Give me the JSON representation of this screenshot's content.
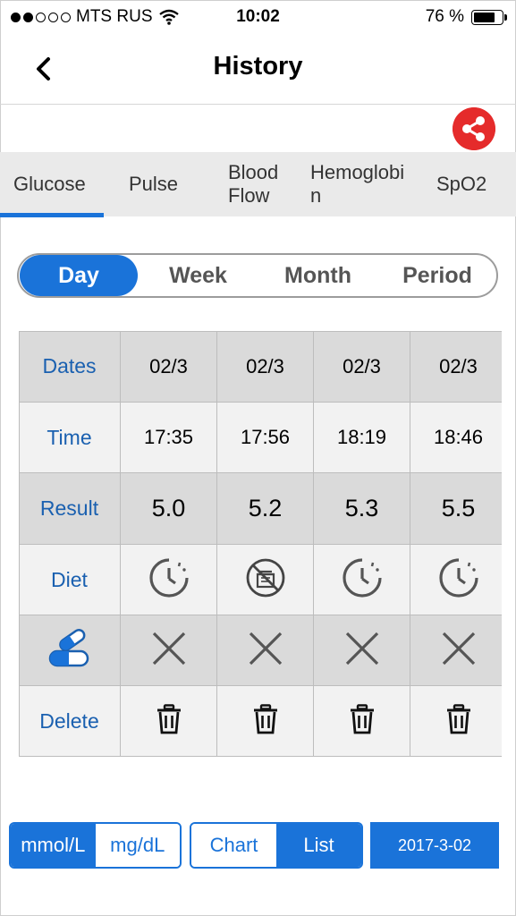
{
  "status_bar": {
    "carrier": "MTS RUS",
    "time": "10:02",
    "battery": "76 %",
    "battery_level": 0.76,
    "signal_bars_filled": 2,
    "signal_bars_total": 5
  },
  "nav": {
    "title": "History",
    "back_icon": "chevron-left-icon"
  },
  "share_icon": "share-icon",
  "tabs": [
    {
      "label": "Glucose",
      "selected": true
    },
    {
      "label": "Pulse"
    },
    {
      "label": "Blood Flow"
    },
    {
      "label": "Hemoglobin"
    },
    {
      "label": "SpO2"
    }
  ],
  "periods": [
    {
      "label": "Day",
      "selected": true
    },
    {
      "label": "Week"
    },
    {
      "label": "Month"
    },
    {
      "label": "Period"
    }
  ],
  "table": {
    "row_labels": {
      "dates": "Dates",
      "time": "Time",
      "result": "Result",
      "diet": "Diet",
      "medication_icon": "pill-icon",
      "delete": "Delete"
    },
    "columns": [
      {
        "date": "02/3",
        "time": "17:35",
        "result": "5.0",
        "diet_icon": "clock-icon",
        "medication_icon": "x-icon",
        "delete_icon": "trash-icon"
      },
      {
        "date": "02/3",
        "time": "17:56",
        "result": "5.2",
        "diet_icon": "no-food-icon",
        "medication_icon": "x-icon",
        "delete_icon": "trash-icon"
      },
      {
        "date": "02/3",
        "time": "18:19",
        "result": "5.3",
        "diet_icon": "clock-icon",
        "medication_icon": "x-icon",
        "delete_icon": "trash-icon"
      },
      {
        "date": "02/3",
        "time": "18:46",
        "result": "5.5",
        "diet_icon": "clock-icon",
        "medication_icon": "x-icon",
        "delete_icon": "trash-icon"
      }
    ]
  },
  "bottom": {
    "units": [
      {
        "label": "mmol/L",
        "selected": true
      },
      {
        "label": "mg/dL"
      }
    ],
    "views": [
      {
        "label": "Chart"
      },
      {
        "label": "List",
        "selected": true
      }
    ],
    "date_button": "2017-3-02"
  },
  "colors": {
    "accent": "#1a73d9",
    "share": "#e52b2b",
    "header_text": "#1a60b0",
    "tab_bg": "#eaeaea"
  }
}
